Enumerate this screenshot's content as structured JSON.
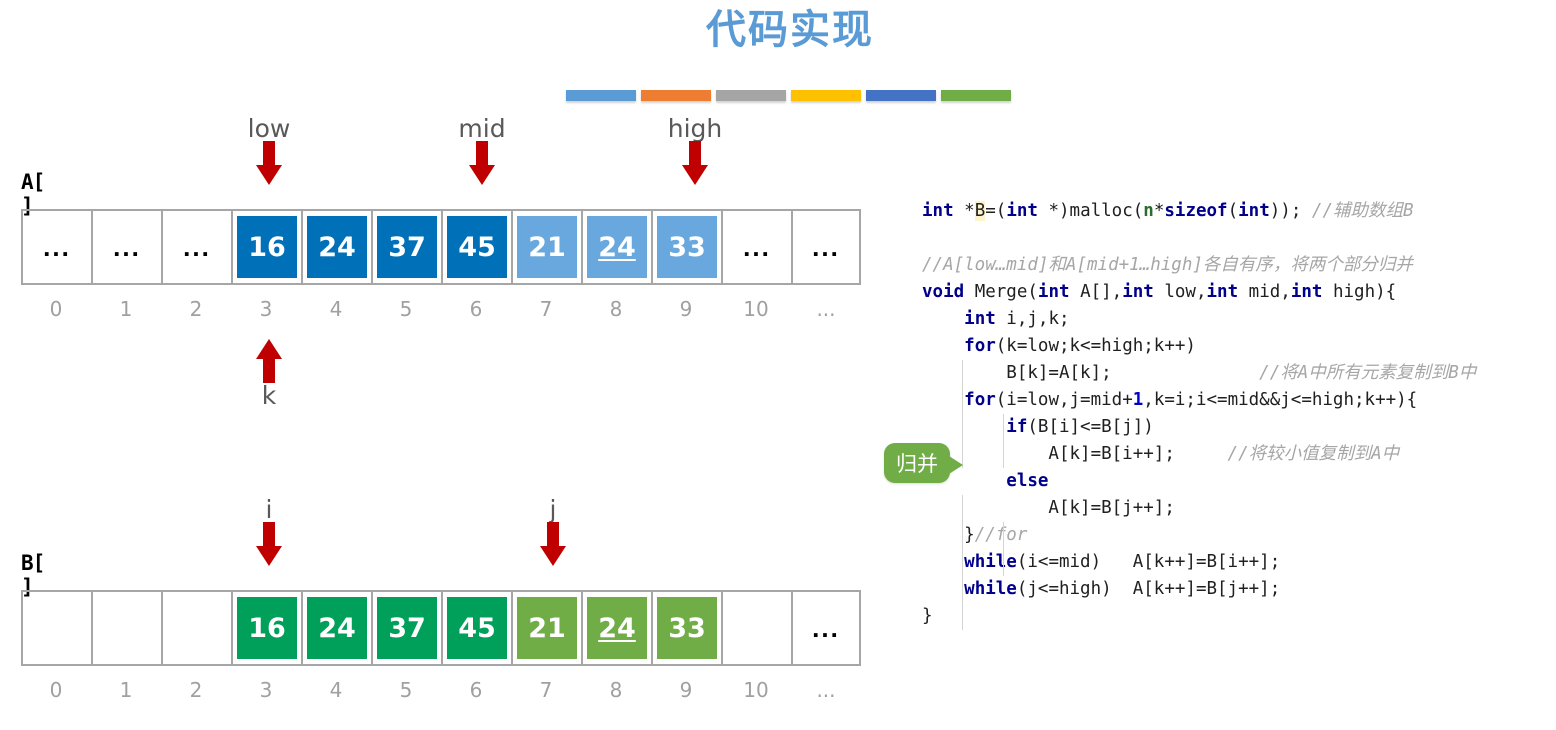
{
  "title": "代码实现",
  "accent_bars": [
    {
      "name": "bar-blue",
      "color": "#5b9bd5"
    },
    {
      "name": "bar-orange",
      "color": "#ed7d31"
    },
    {
      "name": "bar-gray",
      "color": "#a5a5a5"
    },
    {
      "name": "bar-yellow",
      "color": "#ffc000"
    },
    {
      "name": "bar-darkblue",
      "color": "#4472c4"
    },
    {
      "name": "bar-green",
      "color": "#70ad47"
    }
  ],
  "colors": {
    "title": "#5b9bd5",
    "arrow": "#c00000",
    "a_dark": "#0070b8",
    "a_light": "#69a8de",
    "b_dark": "#00a05a",
    "b_light": "#70ad47",
    "border": "#a6a6a6",
    "index": "#a0a0a0",
    "pointer_label": "#595959",
    "callout": "#70ad47",
    "keyword": "#00008b",
    "comment": "#a6a6a6"
  },
  "array_a": {
    "label": "A[ ]",
    "indices": [
      "0",
      "1",
      "2",
      "3",
      "4",
      "5",
      "6",
      "7",
      "8",
      "9",
      "10",
      "..."
    ],
    "cells": [
      {
        "text": "...",
        "kind": "dots"
      },
      {
        "text": "...",
        "kind": "dots"
      },
      {
        "text": "...",
        "kind": "dots"
      },
      {
        "text": "16",
        "kind": "chip",
        "shade": "dark",
        "underline": false
      },
      {
        "text": "24",
        "kind": "chip",
        "shade": "dark",
        "underline": false
      },
      {
        "text": "37",
        "kind": "chip",
        "shade": "dark",
        "underline": false
      },
      {
        "text": "45",
        "kind": "chip",
        "shade": "dark",
        "underline": false
      },
      {
        "text": "21",
        "kind": "chip",
        "shade": "light",
        "underline": false
      },
      {
        "text": "24",
        "kind": "chip",
        "shade": "light",
        "underline": true
      },
      {
        "text": "33",
        "kind": "chip",
        "shade": "light",
        "underline": false
      },
      {
        "text": "...",
        "kind": "dots"
      },
      {
        "text": "...",
        "kind": "dots"
      }
    ],
    "pointers_above": [
      {
        "label": "low",
        "index": 3
      },
      {
        "label": "mid",
        "index": 6
      },
      {
        "label": "high",
        "index": 9
      }
    ],
    "pointers_below": [
      {
        "label": "k",
        "index": 3
      }
    ]
  },
  "array_b": {
    "label": "B[ ]",
    "indices": [
      "0",
      "1",
      "2",
      "3",
      "4",
      "5",
      "6",
      "7",
      "8",
      "9",
      "10",
      "..."
    ],
    "cells": [
      {
        "text": "",
        "kind": "empty"
      },
      {
        "text": "",
        "kind": "empty"
      },
      {
        "text": "",
        "kind": "empty"
      },
      {
        "text": "16",
        "kind": "chip",
        "shade": "dark",
        "underline": false
      },
      {
        "text": "24",
        "kind": "chip",
        "shade": "dark",
        "underline": false
      },
      {
        "text": "37",
        "kind": "chip",
        "shade": "dark",
        "underline": false
      },
      {
        "text": "45",
        "kind": "chip",
        "shade": "dark",
        "underline": false
      },
      {
        "text": "21",
        "kind": "chip",
        "shade": "light",
        "underline": false
      },
      {
        "text": "24",
        "kind": "chip",
        "shade": "light",
        "underline": true
      },
      {
        "text": "33",
        "kind": "chip",
        "shade": "light",
        "underline": false
      },
      {
        "text": "",
        "kind": "empty"
      },
      {
        "text": "...",
        "kind": "dots"
      }
    ],
    "pointers_above": [
      {
        "label": "i",
        "index": 3
      },
      {
        "label": "j",
        "index": 7
      }
    ],
    "pointers_below": []
  },
  "callout": {
    "text": "归并"
  },
  "code": {
    "lines": [
      "int *B=(int *)malloc(n*sizeof(int)); //辅助数组B",
      "",
      "//A[low…mid]和A[mid+1…high]各自有序，将两个部分归并",
      "void Merge(int A[],int low,int mid,int high){",
      "    int i,j,k;",
      "    for(k=low;k<=high;k++)",
      "        B[k]=A[k];              //将A中所有元素复制到B中",
      "    for(i=low,j=mid+1,k=i;i<=mid&&j<=high;k++){",
      "        if(B[i]<=B[j])",
      "            A[k]=B[i++];     //将较小值复制到A中",
      "        else",
      "            A[k]=B[j++];",
      "    }//for",
      "    while(i<=mid)   A[k++]=B[i++];",
      "    while(j<=high)  A[k++]=B[j++];",
      "}"
    ]
  }
}
